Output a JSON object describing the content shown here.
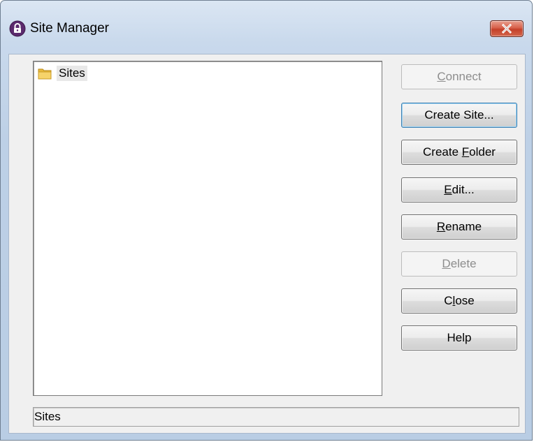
{
  "window": {
    "title": "Site Manager"
  },
  "tree": {
    "items": [
      {
        "label": "Sites",
        "icon": "folder-icon"
      }
    ]
  },
  "buttons": {
    "connect": {
      "pre": "",
      "key": "C",
      "post": "onnect",
      "enabled": false
    },
    "create_site": {
      "pre": "Create Site...",
      "key": "",
      "post": "",
      "enabled": true
    },
    "create_folder": {
      "pre": "Create ",
      "key": "F",
      "post": "older",
      "enabled": true
    },
    "edit": {
      "pre": "",
      "key": "E",
      "post": "dit...",
      "enabled": true
    },
    "rename": {
      "pre": "",
      "key": "R",
      "post": "ename",
      "enabled": true
    },
    "delete": {
      "pre": "",
      "key": "D",
      "post": "elete",
      "enabled": false
    },
    "close": {
      "pre": "C",
      "key": "l",
      "post": "ose",
      "enabled": true
    },
    "help": {
      "pre": "Help",
      "key": "",
      "post": "",
      "enabled": true
    }
  },
  "status": {
    "text": "Sites"
  },
  "colors": {
    "accent": "#3c7fb1",
    "close_button": "#c4402a",
    "app_icon": "#5b2a6e"
  }
}
